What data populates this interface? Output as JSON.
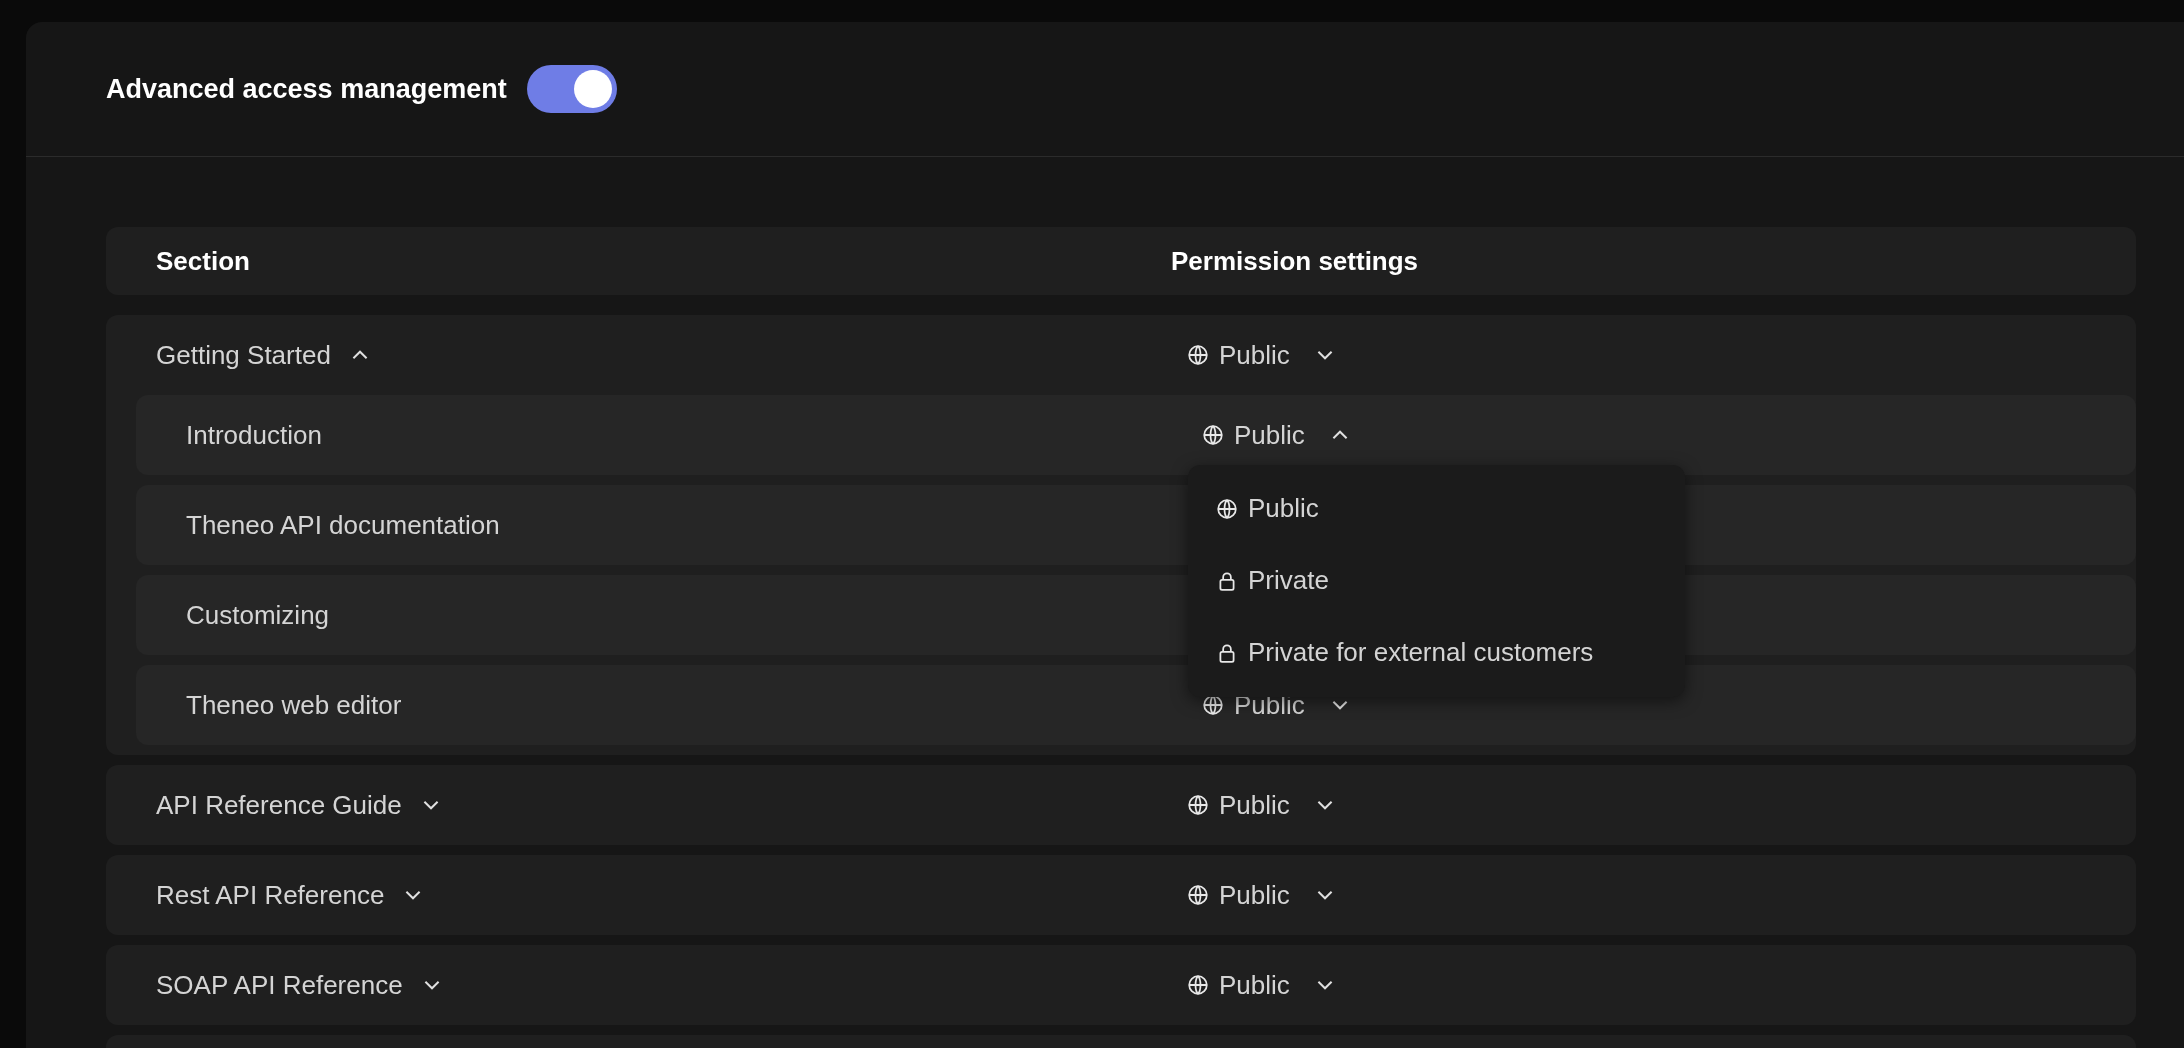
{
  "header": {
    "label": "Advanced access management",
    "toggle_on": true
  },
  "table": {
    "columns": [
      "Section",
      "Permission settings"
    ],
    "groups": [
      {
        "name": "Getting Started",
        "expanded": true,
        "permission": {
          "kind": "public",
          "label": "Public",
          "open": false
        },
        "children": [
          {
            "name": "Introduction",
            "permission": {
              "kind": "public",
              "label": "Public",
              "open": true
            }
          },
          {
            "name": "Theneo API documentation"
          },
          {
            "name": "Customizing"
          },
          {
            "name": "Theneo web editor",
            "permission": {
              "kind": "public",
              "label": "Public",
              "open": false
            }
          }
        ]
      },
      {
        "name": "API Reference Guide",
        "expanded": false,
        "permission": {
          "kind": "public",
          "label": "Public",
          "open": false
        }
      },
      {
        "name": "Rest API Reference",
        "expanded": false,
        "permission": {
          "kind": "public",
          "label": "Public",
          "open": false
        }
      },
      {
        "name": "SOAP API Reference",
        "expanded": false,
        "permission": {
          "kind": "public",
          "label": "Public",
          "open": false
        }
      }
    ]
  },
  "menu": {
    "options": [
      {
        "kind": "public",
        "label": "Public"
      },
      {
        "kind": "private",
        "label": "Private"
      },
      {
        "kind": "private",
        "label": "Private for external customers"
      }
    ]
  }
}
